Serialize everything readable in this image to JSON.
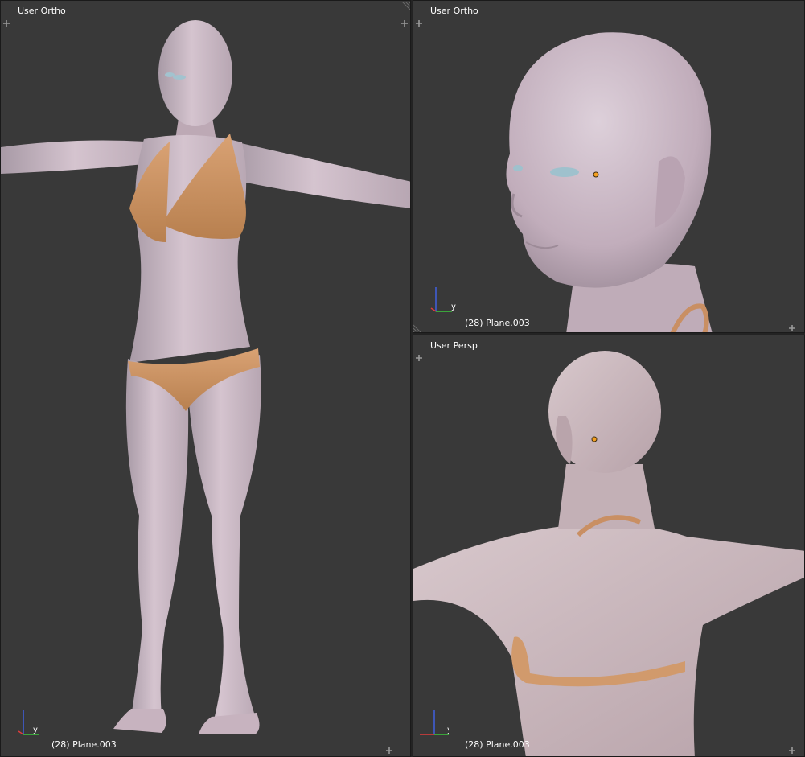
{
  "viewports": {
    "left": {
      "view_label": "User Ortho",
      "object_label": "(28) Plane.003",
      "axis_y_label": "y"
    },
    "top_right": {
      "view_label": "User Ortho",
      "object_label": "(28) Plane.003",
      "axis_y_label": "y"
    },
    "bottom_right": {
      "view_label": "User Persp",
      "object_label": "(28) Plane.003",
      "axis_y_label": "y"
    }
  },
  "colors": {
    "viewport_bg": "#393939",
    "skin": "#c9b4c0",
    "bikini": "#d19a6c",
    "axis_x": "#e03c3c",
    "axis_y": "#3cc83c",
    "axis_z": "#4060e0",
    "origin": "#f5a020"
  },
  "icons": {
    "corner": "plus-icon",
    "origin": "object-origin-icon",
    "gizmo": "axis-gizmo-icon"
  }
}
